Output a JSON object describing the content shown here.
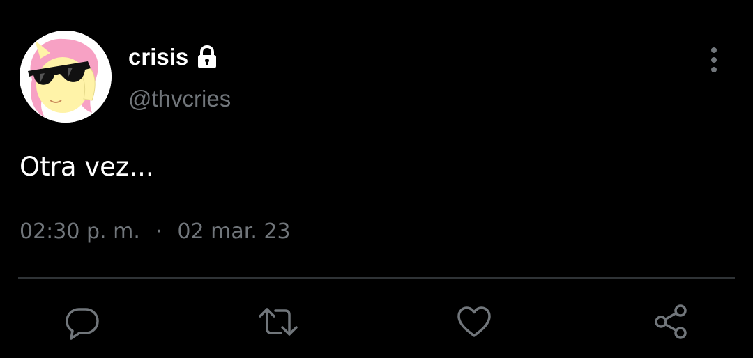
{
  "tweet": {
    "author": {
      "display_name": "crisis",
      "handle": "@thvcries",
      "protected": true,
      "avatar": "yellow pony with pink mane wearing black sunglasses"
    },
    "text": "Otra vez...",
    "time": "02:30 p. m.",
    "separator": "·",
    "date": "02 mar. 23"
  },
  "icons": {
    "lock": "lock-icon",
    "more": "more-vertical-icon",
    "reply": "reply-icon",
    "retweet": "retweet-icon",
    "like": "heart-icon",
    "share": "share-icon"
  },
  "colors": {
    "background": "#000000",
    "primary_text": "#ffffff",
    "secondary_text": "#71767b",
    "divider": "#2f3336"
  }
}
